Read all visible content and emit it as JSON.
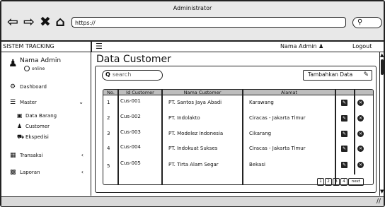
{
  "window": {
    "title": "Administrator"
  },
  "browser": {
    "url": "https://",
    "search_icon": "search-icon"
  },
  "topbar": {
    "brand": "SISTEM TRACKING",
    "user": "Nama Admin",
    "logout": "Logout"
  },
  "sidebar": {
    "profile_name": "Nama Admin",
    "profile_status": "online",
    "items": [
      {
        "label": "Dashboard",
        "icon": "dashboard-icon"
      },
      {
        "label": "Master",
        "icon": "list-icon"
      },
      {
        "label": "Transaksi",
        "icon": "table-icon"
      },
      {
        "label": "Laporan",
        "icon": "calendar-icon"
      }
    ],
    "subitems": [
      {
        "label": "Data Barang",
        "icon": "box-icon"
      },
      {
        "label": "Customer",
        "icon": "users-icon"
      },
      {
        "label": "Ekspedisi",
        "icon": "truck-icon"
      }
    ]
  },
  "main": {
    "title": "Data Customer",
    "search_placeholder": "search",
    "add_button": "Tambahkan Data",
    "table": {
      "headers": [
        "No.",
        "Id Customer",
        "Nama Customer",
        "Alamat"
      ],
      "rows": [
        {
          "no": "1",
          "id": "Cus-001",
          "nama": "PT. Santos Jaya Abadi",
          "alamat": "Karawang"
        },
        {
          "no": "2",
          "id": "Cus-002",
          "nama": "PT. Indolakto",
          "alamat": "Ciracas - Jakarta Timur"
        },
        {
          "no": "3",
          "id": "Cus-003",
          "nama": "PT. Modelez Indonesia",
          "alamat": "Cikarang"
        },
        {
          "no": "4",
          "id": "Cus-004",
          "nama": "PT. Indokuat Sukses",
          "alamat": "Ciracas - Jakarta Timur"
        },
        {
          "no": "5",
          "id": "Cus-005",
          "nama": "PT. Tirta Alam Segar",
          "alamat": "Bekasi"
        }
      ]
    },
    "pagination": {
      "pages": [
        "1",
        "2",
        "3",
        "4"
      ],
      "next": "next"
    }
  }
}
